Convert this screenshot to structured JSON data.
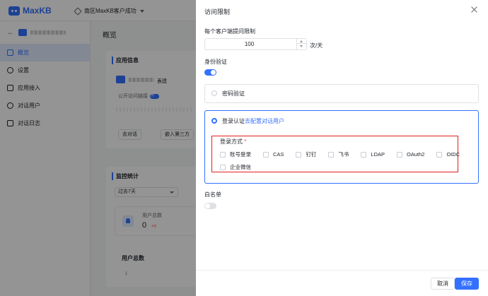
{
  "app": {
    "logo_text": "MaxKB",
    "workspace": "南区MaxKB客户成功"
  },
  "sidebar": {
    "items": [
      {
        "label": "概览",
        "icon": "grid-icon"
      },
      {
        "label": "设置",
        "icon": "gear-icon"
      },
      {
        "label": "应用接入",
        "icon": "plug-icon"
      },
      {
        "label": "对话用户",
        "icon": "user-icon"
      },
      {
        "label": "对话日志",
        "icon": "document-icon"
      }
    ]
  },
  "main": {
    "title": "概览",
    "app_info": {
      "title": "应用信息",
      "name_visible": "表建",
      "public_link_label": "公开访问链接",
      "public_link_switch": "开",
      "buttons": [
        "去对话",
        "嵌入第三方"
      ]
    },
    "monitor": {
      "title": "监控统计",
      "range": "过去7天",
      "stat_label": "用户总数",
      "stat_value": "0",
      "stat_delta": "+0",
      "chart_title": "用户总数",
      "chart_tick": "1"
    }
  },
  "drawer": {
    "title": "访问限制",
    "limit": {
      "label": "每个客户端提问限制",
      "value": "100",
      "unit": "次/天"
    },
    "auth": {
      "label": "身份验证",
      "enabled": true,
      "password_option": "密码验证",
      "login_option": "登录认证",
      "login_link": "去配置对话用户",
      "methods_label": "登录方式",
      "required_mark": "*",
      "methods_row1": [
        "账号登录",
        "CAS",
        "钉钉",
        "飞书",
        "LDAP",
        "OAuth2",
        "OIDC"
      ],
      "methods_row2": [
        "企业微信"
      ]
    },
    "whitelist": {
      "label": "白名单",
      "enabled": false
    },
    "footer": {
      "cancel": "取消",
      "save": "保存"
    }
  },
  "colors": {
    "primary": "#3370ff",
    "highlight": "#e02020",
    "danger": "#f54a45"
  }
}
